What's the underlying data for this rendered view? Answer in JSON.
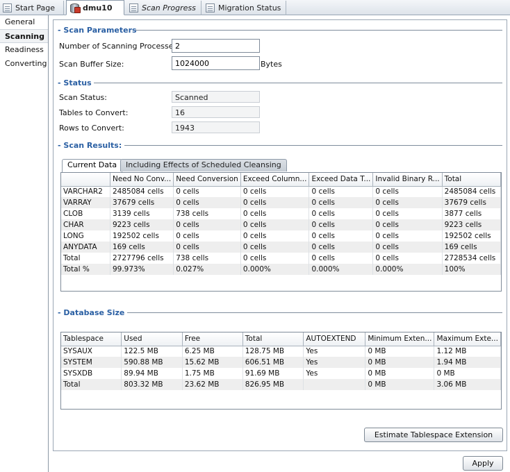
{
  "tabs": [
    {
      "label": "Start Page",
      "icon": "page-icon"
    },
    {
      "label": "dmu10",
      "icon": "database-icon"
    },
    {
      "label": "Scan Progress",
      "icon": "page-icon"
    },
    {
      "label": "Migration Status",
      "icon": "page-icon"
    }
  ],
  "nav": [
    "General",
    "Scanning",
    "Readiness",
    "Converting"
  ],
  "scan_params": {
    "title": "Scan Parameters",
    "processes_label": "Number of Scanning Processes:",
    "processes_value": "2",
    "buffer_label": "Scan Buffer Size:",
    "buffer_value": "1024000",
    "buffer_unit": "Bytes"
  },
  "status": {
    "title": "Status",
    "scan_status_label": "Scan Status:",
    "scan_status_value": "Scanned",
    "tables_label": "Tables to Convert:",
    "tables_value": "16",
    "rows_label": "Rows to Convert:",
    "rows_value": "1943"
  },
  "scan_results": {
    "title": "Scan Results:",
    "tab_current": "Current Data",
    "tab_cleansing": "Including Effects of Scheduled Cleansing",
    "columns": [
      "",
      "Need No Conv...",
      "Need Conversion",
      "Exceed Column...",
      "Exceed Data T...",
      "Invalid Binary R...",
      "Total"
    ],
    "rows": [
      [
        "VARCHAR2",
        "2485084 cells",
        "0 cells",
        "0 cells",
        "0 cells",
        "0 cells",
        "2485084 cells"
      ],
      [
        "VARRAY",
        "37679 cells",
        "0 cells",
        "0 cells",
        "0 cells",
        "0 cells",
        "37679 cells"
      ],
      [
        "CLOB",
        "3139 cells",
        "738 cells",
        "0 cells",
        "0 cells",
        "0 cells",
        "3877 cells"
      ],
      [
        "CHAR",
        "9223 cells",
        "0 cells",
        "0 cells",
        "0 cells",
        "0 cells",
        "9223 cells"
      ],
      [
        "LONG",
        "192502 cells",
        "0 cells",
        "0 cells",
        "0 cells",
        "0 cells",
        "192502 cells"
      ],
      [
        "ANYDATA",
        "169 cells",
        "0 cells",
        "0 cells",
        "0 cells",
        "0 cells",
        "169 cells"
      ],
      [
        "Total",
        "2727796 cells",
        "738 cells",
        "0 cells",
        "0 cells",
        "0 cells",
        "2728534 cells"
      ],
      [
        "Total %",
        "99.973%",
        "0.027%",
        "0.000%",
        "0.000%",
        "0.000%",
        "100%"
      ]
    ]
  },
  "db_size": {
    "title": "Database Size",
    "columns": [
      "Tablespace",
      "Used",
      "Free",
      "Total",
      "AUTOEXTEND",
      "Minimum Exten...",
      "Maximum Exte..."
    ],
    "rows": [
      [
        "SYSAUX",
        "122.5 MB",
        "6.25 MB",
        "128.75 MB",
        "Yes",
        "0 MB",
        "1.12 MB"
      ],
      [
        "SYSTEM",
        "590.88 MB",
        "15.62 MB",
        "606.51 MB",
        "Yes",
        "0 MB",
        "1.94 MB"
      ],
      [
        "SYSXDB",
        "89.94 MB",
        "1.75 MB",
        "91.69 MB",
        "Yes",
        "0 MB",
        "0 MB"
      ],
      [
        "Total",
        "803.32 MB",
        "23.62 MB",
        "826.95 MB",
        "",
        "0 MB",
        "3.06 MB"
      ]
    ]
  },
  "buttons": {
    "estimate": "Estimate Tablespace Extension",
    "apply": "Apply"
  }
}
